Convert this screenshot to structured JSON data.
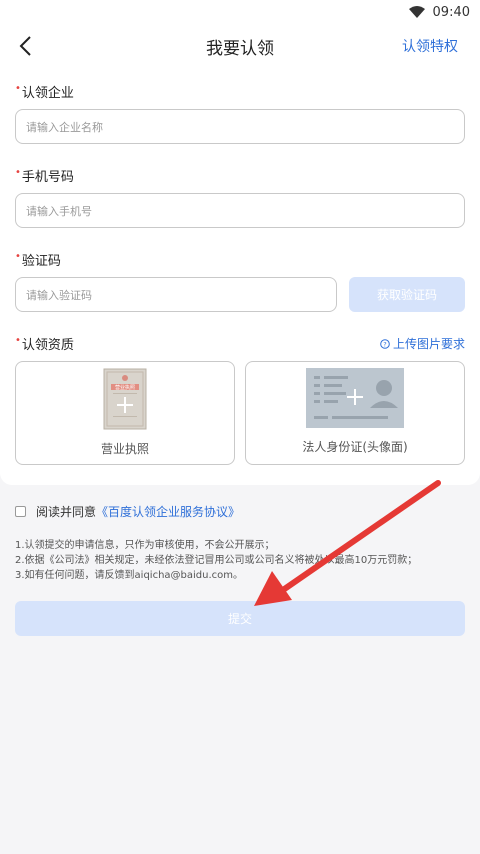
{
  "status_bar": {
    "time": "09:40"
  },
  "header": {
    "title": "我要认领",
    "right_link": "认领特权"
  },
  "form": {
    "company": {
      "label": "认领企业",
      "placeholder": "请输入企业名称"
    },
    "phone": {
      "label": "手机号码",
      "placeholder": "请输入手机号"
    },
    "code": {
      "label": "验证码",
      "placeholder": "请输入验证码",
      "button": "获取验证码"
    },
    "qualification": {
      "label": "认领资质",
      "requirement_link": "上传图片要求",
      "license_label": "营业执照",
      "license_stamp": "营业执照",
      "idcard_label": "法人身份证(头像面)"
    }
  },
  "agreement": {
    "text": "阅读并同意",
    "link": "《百度认领企业服务协议》"
  },
  "notes": [
    "1.认领提交的申请信息，只作为审核使用，不会公开展示；",
    "2.依据《公司法》相关规定，未经依法登记冒用公司或公司名义将被处以最高10万元罚款；",
    "3.如有任何问题，请反馈到aiqicha@baidu.com。"
  ],
  "submit_label": "提交",
  "colors": {
    "accent": "#2e6fd8",
    "required": "#e64340",
    "disabled_button": "#d6e3fb",
    "annotation_arrow": "#e53935"
  }
}
